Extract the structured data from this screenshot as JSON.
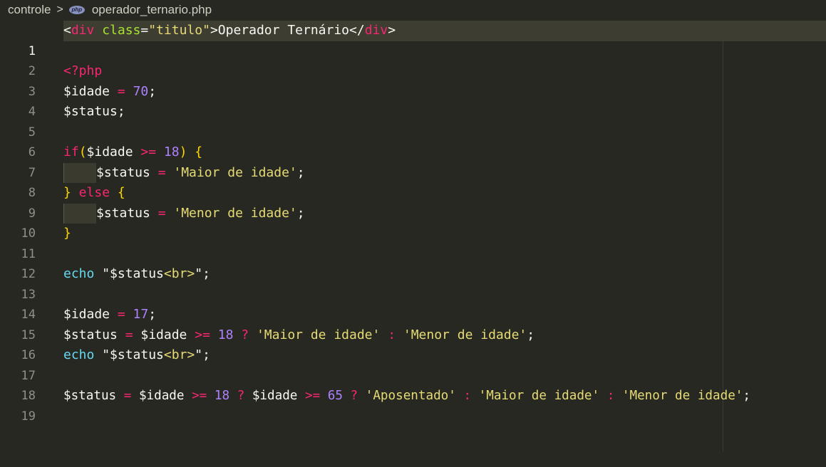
{
  "breadcrumb": {
    "folder": "controle",
    "separator": ">",
    "file_icon": "php",
    "file": "operador_ternario.php"
  },
  "editor": {
    "active_line": 1,
    "lines": [
      {
        "n": "1"
      },
      {
        "n": "2"
      },
      {
        "n": "3"
      },
      {
        "n": "4"
      },
      {
        "n": "5"
      },
      {
        "n": "6"
      },
      {
        "n": "7"
      },
      {
        "n": "8"
      },
      {
        "n": "9"
      },
      {
        "n": "10"
      },
      {
        "n": "11"
      },
      {
        "n": "12"
      },
      {
        "n": "13"
      },
      {
        "n": "14"
      },
      {
        "n": "15"
      },
      {
        "n": "16"
      },
      {
        "n": "17"
      },
      {
        "n": "18"
      },
      {
        "n": "19"
      }
    ],
    "tokens": {
      "l1": [
        "<",
        "div",
        " ",
        "class",
        "=",
        "\"titulo\"",
        ">",
        "Operador Ternário",
        "</",
        "div",
        ">"
      ],
      "l3": [
        "<?php"
      ],
      "l4": [
        "$idade",
        " = ",
        "70",
        ";"
      ],
      "l5": [
        "$status;"
      ],
      "l7": [
        "if",
        "(",
        "$idade",
        " >= ",
        "18",
        ") ",
        "{"
      ],
      "l8": [
        "$status",
        " = ",
        "'Maior de idade'",
        ";"
      ],
      "l9": [
        "}",
        " else ",
        "{"
      ],
      "l10": [
        "$status",
        " = ",
        "'Menor de idade'",
        ";"
      ],
      "l11": [
        "}"
      ],
      "l13": [
        "echo",
        " ",
        "\"$status",
        "<br>",
        "\";"
      ],
      "l15": [
        "$idade",
        " = ",
        "17",
        ";"
      ],
      "l16": [
        "$status",
        " = ",
        "$idade",
        " >= ",
        "18",
        " ? ",
        "'Maior de idade'",
        " : ",
        "'Menor de idade'",
        ";"
      ],
      "l17": [
        "echo",
        " ",
        "\"$status",
        "<br>",
        "\";"
      ],
      "l19": [
        "$status",
        " = ",
        "$idade",
        " >= ",
        "18",
        " ? ",
        "$idade",
        " >= ",
        "65",
        " ? ",
        "'Aposentado'",
        " : ",
        "'Maior de idade'",
        " : ",
        "'Menor de idade'",
        ";"
      ]
    }
  },
  "colors": {
    "background": "#272822",
    "keyword": "#f92672",
    "string": "#e6db74",
    "number": "#ae81ff",
    "function": "#66d9ef",
    "attribute": "#a6e22e",
    "brace": "#ffd700"
  }
}
